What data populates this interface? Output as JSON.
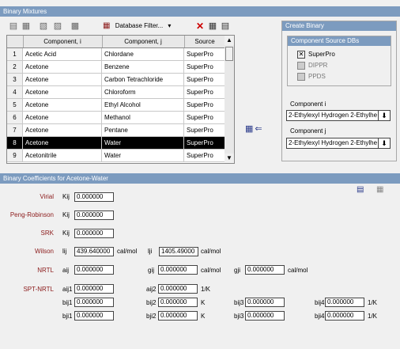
{
  "binary_mixtures": {
    "title": "Binary Mixtures",
    "db_filter_label": "Database Filter...",
    "columns": [
      "",
      "Component, i",
      "Component, j",
      "Source"
    ],
    "rows": [
      {
        "num": "1",
        "ci": "Acetic Acid",
        "cj": "Chlordane",
        "source": "SuperPro",
        "selected": false
      },
      {
        "num": "2",
        "ci": "Acetone",
        "cj": "Benzene",
        "source": "SuperPro",
        "selected": false
      },
      {
        "num": "3",
        "ci": "Acetone",
        "cj": "Carbon Tetrachloride",
        "source": "SuperPro",
        "selected": false
      },
      {
        "num": "4",
        "ci": "Acetone",
        "cj": "Chloroform",
        "source": "SuperPro",
        "selected": false
      },
      {
        "num": "5",
        "ci": "Acetone",
        "cj": "Ethyl Alcohol",
        "source": "SuperPro",
        "selected": false
      },
      {
        "num": "6",
        "ci": "Acetone",
        "cj": "Methanol",
        "source": "SuperPro",
        "selected": false
      },
      {
        "num": "7",
        "ci": "Acetone",
        "cj": "Pentane",
        "source": "SuperPro",
        "selected": false
      },
      {
        "num": "8",
        "ci": "Acetone",
        "cj": "Water",
        "source": "SuperPro",
        "selected": true
      },
      {
        "num": "9",
        "ci": "Acetonitrile",
        "cj": "Water",
        "source": "SuperPro",
        "selected": false
      }
    ]
  },
  "create_binary": {
    "title": "Create Binary",
    "group_title": "Component Source DBs",
    "sources": [
      {
        "label": "SuperPro",
        "checked": true,
        "enabled": true
      },
      {
        "label": "DIPPR",
        "checked": false,
        "enabled": false
      },
      {
        "label": "PPDS",
        "checked": false,
        "enabled": false
      }
    ],
    "component_i_label": "Component i",
    "component_i_value": "2-Ethylexyl Hydrogen 2-Ethylhex",
    "component_j_label": "Component j",
    "component_j_value": "2-Ethylexyl Hydrogen 2-Ethylhex"
  },
  "coefficients": {
    "title": "Binary Coefficients for Acetone-Water",
    "virial": {
      "label": "Virial",
      "p1": "Kij",
      "v1": "0.000000"
    },
    "peng": {
      "label": "Peng-Robinson",
      "p1": "Kij",
      "v1": "0.000000"
    },
    "srk": {
      "label": "SRK",
      "p1": "Kij",
      "v1": "0.000000"
    },
    "wilson": {
      "label": "Wilson",
      "p1": "lij",
      "v1": "439.640000",
      "u1": "cal/mol",
      "p2": "lji",
      "v2": "1405.49000",
      "u2": "cal/mol"
    },
    "nrtl": {
      "label": "NRTL",
      "p1": "aij",
      "v1": "0.000000",
      "p2": "gij",
      "v2": "0.000000",
      "u2": "cal/mol",
      "p3": "gji",
      "v3": "0.000000",
      "u3": "cal/mol"
    },
    "spt": {
      "label": "SPT-NRTL",
      "aij1_p": "aij1",
      "aij1_v": "0.000000",
      "aij2_p": "aij2",
      "aij2_v": "0.000000",
      "aij2_u": "1/K",
      "bij_p": [
        "bij1",
        "bij2",
        "bij3",
        "bij4"
      ],
      "bij_v": [
        "0.000000",
        "0.000000",
        "0.000000",
        "0.000000"
      ],
      "bij_u": [
        "",
        "K",
        "",
        "1/K"
      ],
      "cij_p": [
        "bji1",
        "bji2",
        "bji3",
        "bji4"
      ],
      "cij_v": [
        "0.000000",
        "0.000000",
        "0.000000",
        "0.000000"
      ],
      "cij_u": [
        "",
        "K",
        "",
        "1/K"
      ]
    }
  }
}
